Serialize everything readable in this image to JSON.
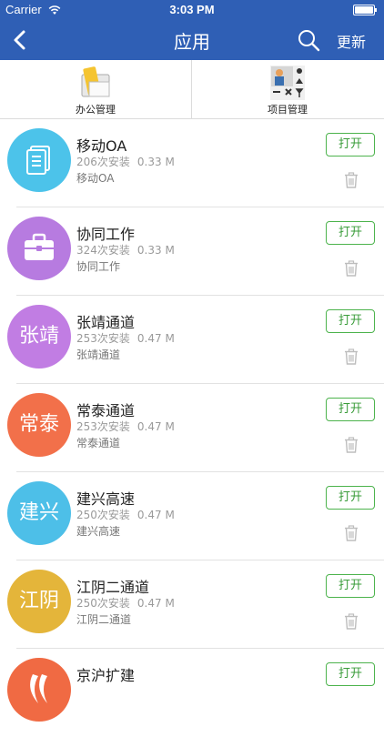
{
  "status": {
    "carrier": "Carrier",
    "time": "3:03 PM"
  },
  "nav": {
    "title": "应用",
    "refresh_label": "更新"
  },
  "categories": [
    {
      "label": "办公管理"
    },
    {
      "label": "项目管理"
    }
  ],
  "open_label": "打开",
  "apps": [
    {
      "name": "移动OA",
      "installs": "206次安装",
      "size": "0.33 M",
      "desc": "移动OA",
      "avatar_text": "",
      "icon": "document-icon",
      "color": "#4cc3ea"
    },
    {
      "name": "协同工作",
      "installs": "324次安装",
      "size": "0.33 M",
      "desc": "协同工作",
      "avatar_text": "",
      "icon": "briefcase-icon",
      "color": "#b77be0"
    },
    {
      "name": "张靖通道",
      "installs": "253次安装",
      "size": "0.47 M",
      "desc": "张靖通道",
      "avatar_text": "张靖",
      "icon": "",
      "color": "#c17de3"
    },
    {
      "name": "常泰通道",
      "installs": "253次安装",
      "size": "0.47 M",
      "desc": "常泰通道",
      "avatar_text": "常泰",
      "icon": "",
      "color": "#f2704a"
    },
    {
      "name": "建兴高速",
      "installs": "250次安装",
      "size": "0.47 M",
      "desc": "建兴高速",
      "avatar_text": "建兴",
      "icon": "",
      "color": "#4dbfe8"
    },
    {
      "name": "江阴二通道",
      "installs": "250次安装",
      "size": "0.47 M",
      "desc": "江阴二通道",
      "avatar_text": "江阴",
      "icon": "",
      "color": "#e4b53a"
    },
    {
      "name": "京沪扩建",
      "installs": "",
      "size": "",
      "desc": "",
      "avatar_text": "",
      "icon": "swoosh-logo-icon",
      "color": "#f06a43"
    }
  ]
}
